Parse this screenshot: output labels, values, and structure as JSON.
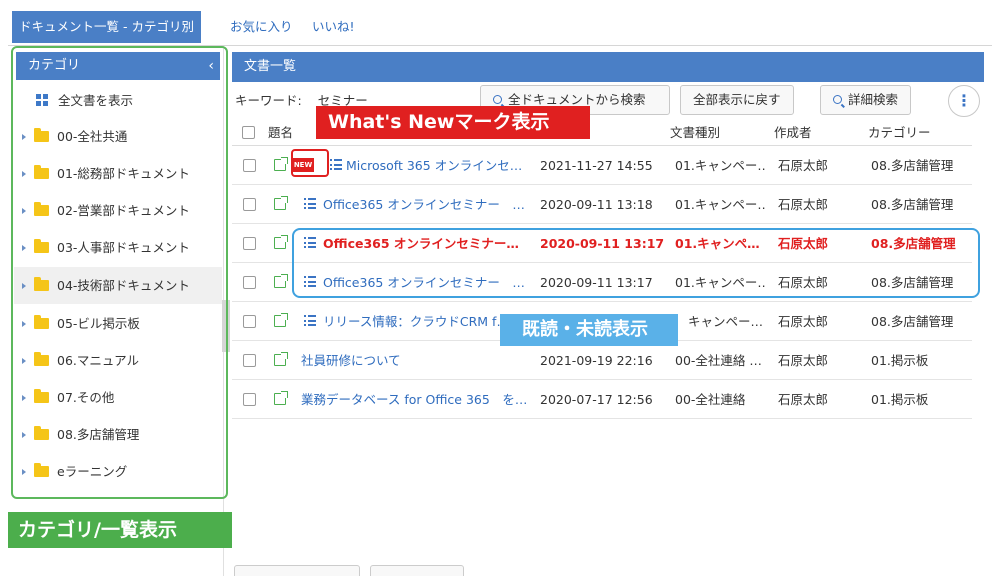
{
  "top_tabs": [
    {
      "label": "ドキュメント一覧 - カテゴリ別"
    },
    {
      "label": "お気に入り"
    },
    {
      "label": "いいね!"
    }
  ],
  "sidebar": {
    "header": "カテゴリ",
    "collapse_icon": "chevron-left-icon",
    "show_all": "全文書を表示",
    "items": [
      {
        "label": "00-全社共通"
      },
      {
        "label": "01-総務部ドキュメント"
      },
      {
        "label": "02-営業部ドキュメント"
      },
      {
        "label": "03-人事部ドキュメント"
      },
      {
        "label": "04-技術部ドキュメント"
      },
      {
        "label": "05-ビル掲示板"
      },
      {
        "label": "06.マニュアル"
      },
      {
        "label": "07.その他"
      },
      {
        "label": "08.多店舗管理"
      },
      {
        "label": "eラーニング"
      }
    ],
    "highlighted_index": 4
  },
  "main": {
    "header": "文書一覧",
    "keyword_label": "キーワード:",
    "keyword_value": "セミナー",
    "buttons": {
      "search_all": "全ドキュメントから検索",
      "reset": "全部表示に戻す",
      "advanced": "詳細検索"
    },
    "columns": [
      "題名",
      "文書種別",
      "作成者",
      "カテゴリー"
    ],
    "rows": [
      {
        "title": "Microsoft 365 オンラインセ…",
        "date": "2021-11-27 14:55",
        "type": "01.キャンペー…",
        "author": "石原太郎",
        "category": "08.多店舗管理",
        "new": true,
        "list": true,
        "red": false
      },
      {
        "title": "Office365 オンラインセミナー　…",
        "date": "2020-09-11 13:18",
        "type": "01.キャンペー…",
        "author": "石原太郎",
        "category": "08.多店舗管理",
        "new": false,
        "list": true,
        "red": false
      },
      {
        "title": "Office365 オンラインセミナー…",
        "date": "2020-09-11 13:17",
        "type": "01.キャンペ…",
        "author": "石原太郎",
        "category": "08.多店舗管理",
        "new": false,
        "list": true,
        "red": true
      },
      {
        "title": "Office365 オンラインセミナー　…",
        "date": "2020-09-11 13:17",
        "type": "01.キャンペー…",
        "author": "石原太郎",
        "category": "08.多店舗管理",
        "new": false,
        "list": true,
        "red": false
      },
      {
        "title": "リリース情報：クラウドCRM f…",
        "date": "",
        "type": "キャンペー…",
        "author": "石原太郎",
        "category": "08.多店舗管理",
        "new": false,
        "list": true,
        "red": false
      },
      {
        "title": "社員研修について",
        "date": "2021-09-19 22:16",
        "type": "00-全社連絡 …",
        "author": "石原太郎",
        "category": "01.掲示板",
        "new": false,
        "list": false,
        "red": false
      },
      {
        "title": "業務データベース for Office 365　を…",
        "date": "2020-07-17 12:56",
        "type": "00-全社連絡",
        "author": "石原太郎",
        "category": "01.掲示板",
        "new": false,
        "list": false,
        "red": false
      }
    ],
    "new_badge": "NEW"
  },
  "annotations": {
    "whats_new": "What's Newマーク表示",
    "read_unread": "既読・未読表示",
    "category_list": "カテゴリ/一覧表示"
  },
  "colors": {
    "header_blue": "#4a7fc6",
    "link_blue": "#2f6cbe",
    "unread_red": "#e02020",
    "folder_yellow": "#f5c518",
    "annotation_green": "#4cae4c",
    "annotation_blue": "#5ab1e8"
  }
}
